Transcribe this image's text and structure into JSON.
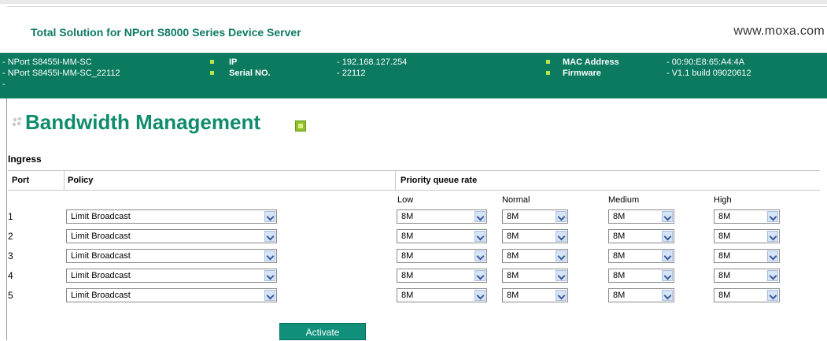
{
  "banner": {
    "title": "Total Solution for NPort S8000 Series Device Server",
    "url": "www.moxa.com"
  },
  "info": {
    "device": [
      "- NPort S8455I-MM-SC",
      "- NPort S8455I-MM-SC_22112",
      "-"
    ],
    "ip_label": "IP",
    "ip_value": "- 192.168.127.254",
    "serial_label": "Serial NO.",
    "serial_value": "- 22112",
    "mac_label": "MAC Address",
    "mac_value": "- 00:90:E8:65:A4:4A",
    "fw_label": "Firmware",
    "fw_value": "- V1.1 build 09020612"
  },
  "page": {
    "title": "Bandwidth Management",
    "section": "Ingress"
  },
  "table": {
    "headers": {
      "port": "Port",
      "policy": "Policy",
      "priority": "Priority queue rate"
    },
    "sub": {
      "low": "Low",
      "normal": "Normal",
      "medium": "Medium",
      "high": "High"
    },
    "rows": [
      {
        "port": "1",
        "policy": "Limit Broadcast",
        "low": "8M",
        "normal": "8M",
        "medium": "8M",
        "high": "8M"
      },
      {
        "port": "2",
        "policy": "Limit Broadcast",
        "low": "8M",
        "normal": "8M",
        "medium": "8M",
        "high": "8M"
      },
      {
        "port": "3",
        "policy": "Limit Broadcast",
        "low": "8M",
        "normal": "8M",
        "medium": "8M",
        "high": "8M"
      },
      {
        "port": "4",
        "policy": "Limit Broadcast",
        "low": "8M",
        "normal": "8M",
        "medium": "8M",
        "high": "8M"
      },
      {
        "port": "5",
        "policy": "Limit Broadcast",
        "low": "8M",
        "normal": "8M",
        "medium": "8M",
        "high": "8M"
      }
    ]
  },
  "actions": {
    "activate": "Activate"
  },
  "colors": {
    "brand": "#0b7a5f",
    "title": "#0f8b6d",
    "bullet": "#b7e64a"
  },
  "icons": {
    "help": "help-icon",
    "dots": "dots-icon",
    "dropdown": "chevron-down-icon"
  }
}
